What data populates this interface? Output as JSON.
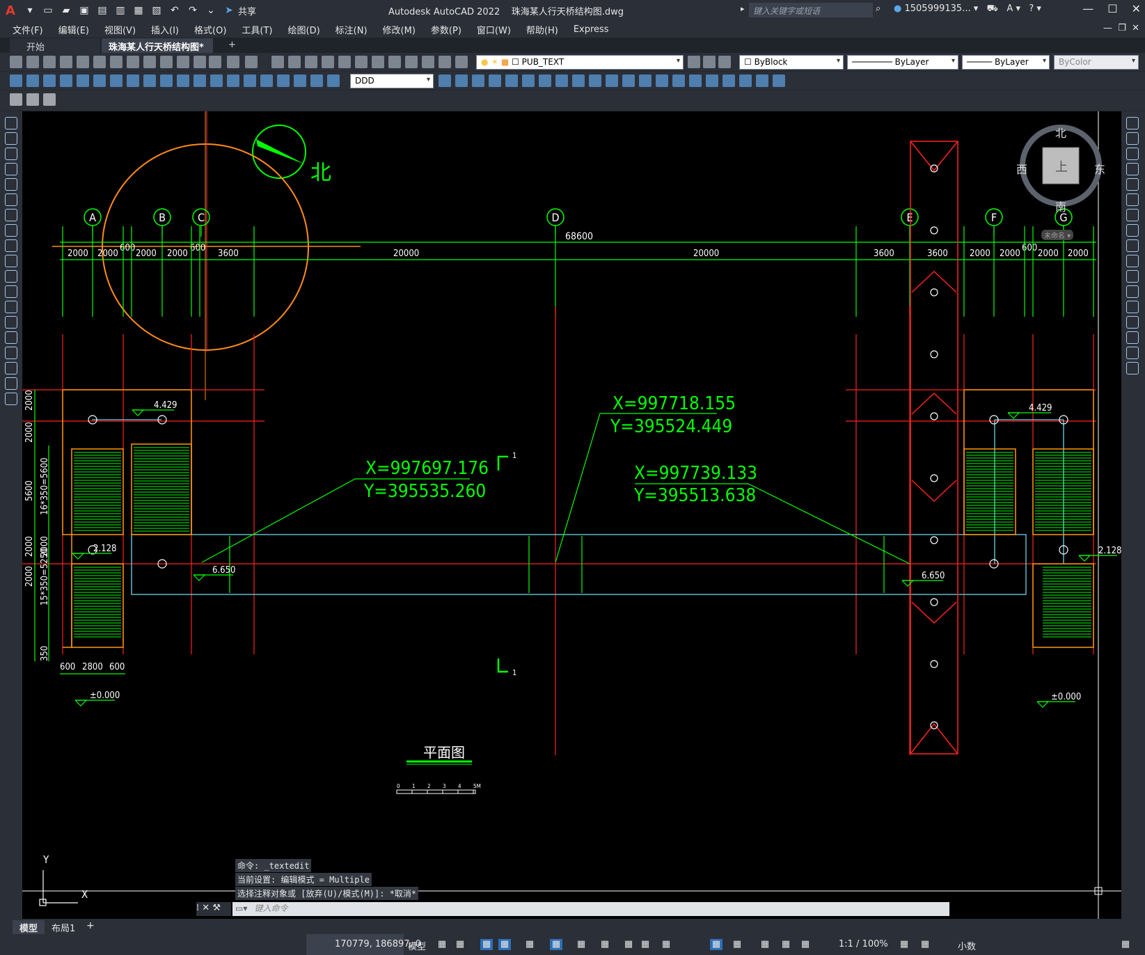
{
  "titlebar": {
    "app": "Autodesk AutoCAD 2022",
    "document": "珠海某人行天桥结构图.dwg",
    "share_label": "共享",
    "search_placeholder": "键入关键字或短语",
    "user": "1505999135...",
    "logo_letter": "A"
  },
  "menu": [
    "文件(F)",
    "编辑(E)",
    "视图(V)",
    "插入(I)",
    "格式(O)",
    "工具(T)",
    "绘图(D)",
    "标注(N)",
    "修改(M)",
    "参数(P)",
    "窗口(W)",
    "帮助(H)",
    "Express"
  ],
  "tabs": [
    {
      "label": "开始"
    },
    {
      "label": "珠海某人行天桥结构图*"
    }
  ],
  "toolbar": {
    "layer_name": "PUB_TEXT",
    "color": "ByBlock",
    "linetype": "ByLayer",
    "lineweight": "ByLayer",
    "plotstyle": "ByColor",
    "dimstyle": "DDD"
  },
  "viewcube": {
    "north": "北",
    "south": "南",
    "east": "东",
    "west": "西",
    "top": "上",
    "wcs": "未命名"
  },
  "drawing": {
    "north_label": "北",
    "grid_labels": [
      "A",
      "B",
      "C",
      "D",
      "E",
      "F",
      "G"
    ],
    "overall_dim": "68600",
    "dims_row": [
      "2000",
      "2000",
      "600",
      "2000",
      "2000",
      "600",
      "3600",
      "20000",
      "20000",
      "3600",
      "3600",
      "2000",
      "2000",
      "600",
      "2000",
      "2000"
    ],
    "coord1": {
      "x": "X=997697.176",
      "y": "Y=395535.260"
    },
    "coord2": {
      "x": "X=997718.155",
      "y": "Y=395524.449"
    },
    "coord3": {
      "x": "X=997739.133",
      "y": "Y=395513.638"
    },
    "elev_top_left": "4.429",
    "elev_top_right": "4.429",
    "elev_mid_left": "2.128",
    "elev_mid_right": "2.128",
    "elev_deck_left": "6.650",
    "elev_deck_right": "6.650",
    "elev_ground_left": "±0.000",
    "elev_ground_right": "±0.000",
    "left_dims": [
      "2000",
      "2000",
      "5600",
      "16*350=5600",
      "2000",
      "2000",
      "2000",
      "5250",
      "15*350=5250",
      "350"
    ],
    "bottom_dims": [
      "600",
      "2800",
      "600"
    ],
    "section_mark": "1",
    "plan_title": "平面图",
    "scale_marks": [
      "0",
      "1",
      "2",
      "3",
      "4",
      "5M"
    ],
    "ucs_x": "X",
    "ucs_y": "Y"
  },
  "command": {
    "lines": [
      "命令: _textedit",
      "当前设置: 编辑模式 = Multiple",
      "选择注释对象或 [放弃(U)/模式(M)]: *取消*"
    ],
    "input_placeholder": "键入命令"
  },
  "layout_tabs": [
    "模型",
    "布局1"
  ],
  "status": {
    "coords": "170779, 186897, 0",
    "space": "模型",
    "scale": "1:1 / 100%",
    "units": "小数"
  }
}
